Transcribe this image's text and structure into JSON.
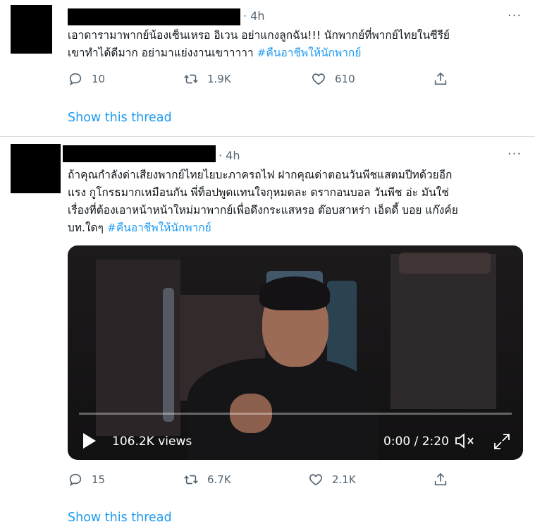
{
  "tweets": [
    {
      "time": "4h",
      "more": "···",
      "text_plain": "เอาดารามาพากย์น้องเซ็นเหรอ อิเวน อย่าแกงลูกฉัน!!! นักพากย์ที่พากย์ไทยในซีรีย์ เขาทำได้ดีมาก อย่ามาแย่งงานเขาาาาา",
      "line1": "เอาดารามาพากย์น้องเซ็นเหรอ อิเวน อย่าแกงลูกฉัน!!! นักพากย์ที่พากย์ไทยในซีรีย์",
      "line2": "เขาทำได้ดีมาก อย่ามาแย่งงานเขาาาาา ",
      "hashtag": "#คืนอาชีพให้นักพากย์",
      "replies": "10",
      "retweets": "1.9K",
      "likes": "610",
      "thread_link": "Show this thread"
    },
    {
      "time": "4h",
      "more": "···",
      "line1": "ถ้าคุณกำลังด่าเสียงพากย์ไทยไยบะภาครถไฟ ฝากคุณด่าตอนวันพีชแสตมปีทด้วยอีก",
      "line2": "แรง กูโกรธมากเหมือนกัน  พี่ท็อปพูดแทนใจกุหมดละ  ดรากอนบอล วันพีช อ่ะ มันใช่",
      "line3": "เรื่องที่ต้องเอาหน้าหน้าใหม่มาพากย์เพื่อดึงกระแสหรอ  ต๊อบสาหร่า เอ็ดดี้ บอย แก๊งค์ย",
      "line4": "บท.ใดๆ ",
      "hashtag": "#คืนอาชีพให้นักพากย์",
      "video": {
        "views": "106.2K views",
        "time": "0:00 / 2:20",
        "progress": 0
      },
      "replies": "15",
      "retweets": "6.7K",
      "likes": "2.1K",
      "thread_link": "Show this thread"
    }
  ],
  "icons": {
    "reply": "reply-icon",
    "retweet": "retweet-icon",
    "like": "like-icon",
    "share": "share-icon",
    "play": "play-icon",
    "mute": "mute-icon",
    "fullscreen": "fullscreen-icon"
  },
  "colors": {
    "accent": "#1d9bf0",
    "muted": "#536471",
    "text": "#0f1419"
  }
}
